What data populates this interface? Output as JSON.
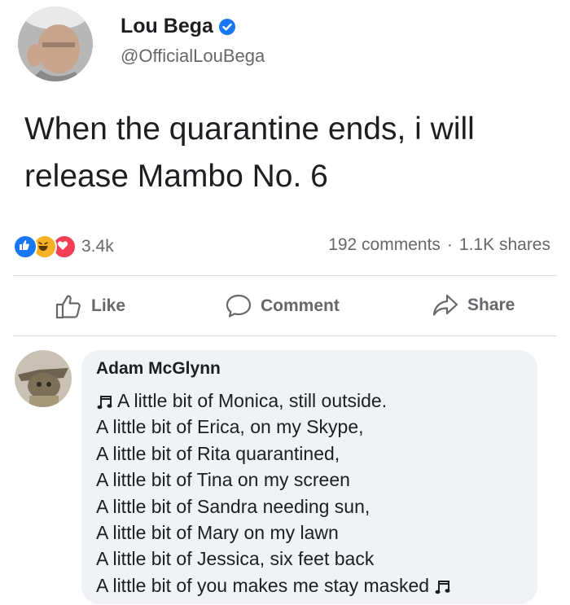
{
  "author": {
    "name": "Lou Bega",
    "handle": "@OfficialLouBega"
  },
  "post": {
    "text_line1": "When the quarantine ends, i will",
    "text_line2": "release Mambo No. 6"
  },
  "engagement": {
    "reaction_count": "3.4k",
    "comments": "192 comments",
    "separator": "·",
    "shares": "1.1K shares"
  },
  "actions": {
    "like": "Like",
    "comment": "Comment",
    "share": "Share"
  },
  "comment": {
    "author": "Adam McGlynn",
    "lines": [
      "A little bit of Monica, still outside.",
      "A little bit of Erica, on my Skype,",
      "A little bit of Rita quarantined,",
      "A little bit of Tina on my screen",
      "A little bit of Sandra needing sun,",
      "A little bit of Mary on my lawn",
      "A little bit of Jessica, six feet back",
      "A little bit of you makes me stay masked"
    ]
  },
  "colors": {
    "like_blue": "#1877f2",
    "haha_yellow": "#f7b125",
    "love_red": "#f33e58",
    "muted_text": "#65676b",
    "bubble_bg": "#f0f2f5"
  },
  "icons": {
    "verified": "verified-badge-icon",
    "like": "thumbs-up-icon",
    "comment": "speech-bubble-icon",
    "share": "share-arrow-icon",
    "music": "music-note-icon"
  }
}
